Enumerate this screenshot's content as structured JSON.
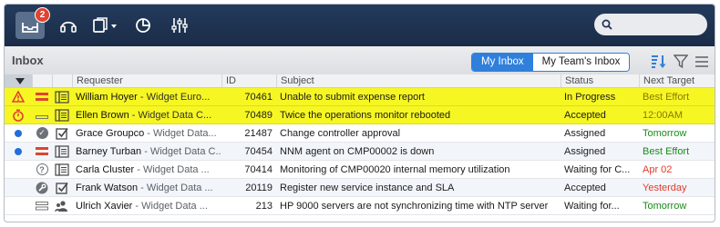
{
  "toolbar": {
    "inbox_badge": "2",
    "search_placeholder": ""
  },
  "titlebar": {
    "title": "Inbox",
    "my_inbox": "My Inbox",
    "team_inbox": "My Team's Inbox"
  },
  "columns": {
    "requester": "Requester",
    "id": "ID",
    "subject": "Subject",
    "status": "Status",
    "next": "Next Target"
  },
  "rows": [
    {
      "name": "William Hoyer",
      "org": " - Widget Euro...",
      "id": "70461",
      "subject": "Unable to submit expense report",
      "status": "In Progress",
      "next": "Best Effort",
      "next_color": "warn",
      "highlight": true,
      "i1": "warning-icon",
      "i2": "priority-high-icon",
      "i3": "ticket-icon"
    },
    {
      "name": "Ellen Brown",
      "org": " - Widget Data C...",
      "id": "70489",
      "subject": "Twice the operations monitor rebooted",
      "status": "Accepted",
      "next": "12:00AM",
      "next_color": "warn",
      "highlight": true,
      "i1": "timer-icon",
      "i2": "priority-low-icon",
      "i3": "ticket-icon"
    },
    {
      "name": "Grace Groupco",
      "org": " - Widget Data...",
      "id": "21487",
      "subject": "Change controller approval",
      "status": "Assigned",
      "next": "Tomorrow",
      "next_color": "ok",
      "highlight": false,
      "i1": "unread-dot-icon",
      "i2": "check-circle-icon",
      "i3": "checkbox-icon"
    },
    {
      "name": "Barney Turban",
      "org": " - Widget Data C...",
      "id": "70454",
      "subject": "NNM agent on CMP00002 is down",
      "status": "Assigned",
      "next": "Best Effort",
      "next_color": "ok",
      "highlight": false,
      "i1": "unread-dot-icon",
      "i2": "priority-high-icon",
      "i3": "ticket-icon"
    },
    {
      "name": "Carla Cluster",
      "org": " - Widget Data ...",
      "id": "70414",
      "subject": "Monitoring of CMP00020 internal memory utilization",
      "status": "Waiting for C...",
      "next": "Apr 02",
      "next_color": "red",
      "highlight": false,
      "i1": "",
      "i2": "question-circle-icon",
      "i3": "ticket-icon"
    },
    {
      "name": "Frank Watson",
      "org": " - Widget Data ...",
      "id": "20119",
      "subject": "Register new service instance and SLA",
      "status": "Accepted",
      "next": "Yesterday",
      "next_color": "red",
      "highlight": false,
      "i1": "",
      "i2": "wrench-circle-icon",
      "i3": "checkbox-icon"
    },
    {
      "name": "Ulrich Xavier",
      "org": " - Widget Data ...",
      "id": "213",
      "subject": "HP 9000 servers are not synchronizing time with NTP server",
      "status": "Waiting for...",
      "next": "Tomorrow",
      "next_color": "ok",
      "highlight": false,
      "i1": "",
      "i2": "priority-medium-icon",
      "i3": "users-icon"
    }
  ]
}
